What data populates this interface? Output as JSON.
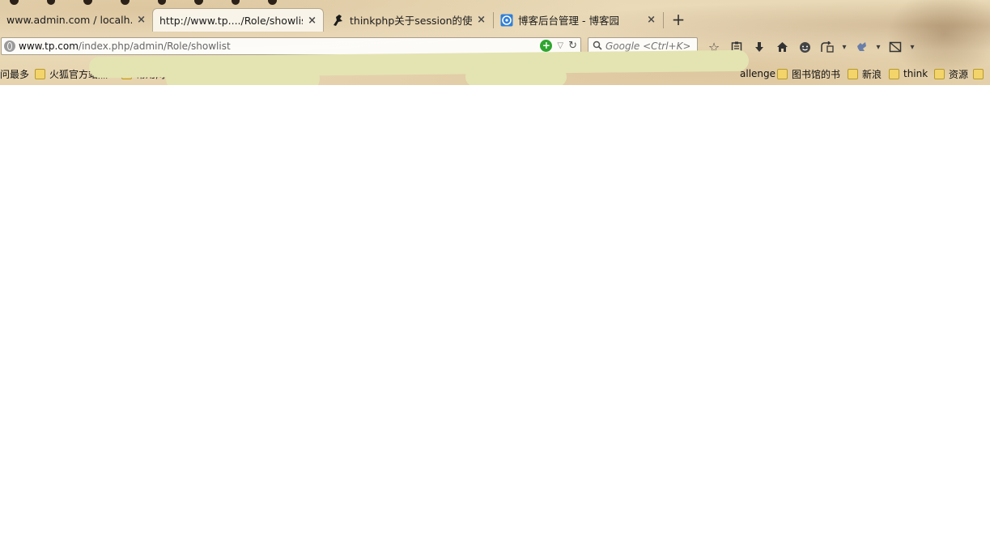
{
  "tabs": [
    {
      "label": "www.admin.com / localh...",
      "active": false
    },
    {
      "label": "http://www.tp..../Role/showlist",
      "active": true
    },
    {
      "label": "thinkphp关于session的使...",
      "active": false
    },
    {
      "label": "博客后台管理 - 博客园",
      "active": false
    }
  ],
  "newtab_label": "+",
  "close_glyph": "×",
  "url": {
    "domain": "www.tp.com",
    "path": "/index.php/admin/Role/showlist"
  },
  "search": {
    "placeholder": "Google <Ctrl+K>"
  },
  "bookmarks": [
    {
      "label": "问最多",
      "folder": false
    },
    {
      "label": "火狐官方站点",
      "folder": true
    },
    {
      "label": "常用网址",
      "folder": true
    },
    {
      "label": "allenge",
      "folder": false
    },
    {
      "label": "图书馆的书",
      "folder": true
    },
    {
      "label": "新浪",
      "folder": true
    },
    {
      "label": "think",
      "folder": true
    },
    {
      "label": "资源",
      "folder": true
    }
  ],
  "colors": {
    "go_icon": "#2ea52e",
    "folder": "#f2d46a",
    "redaction": "#e4e4b3"
  }
}
